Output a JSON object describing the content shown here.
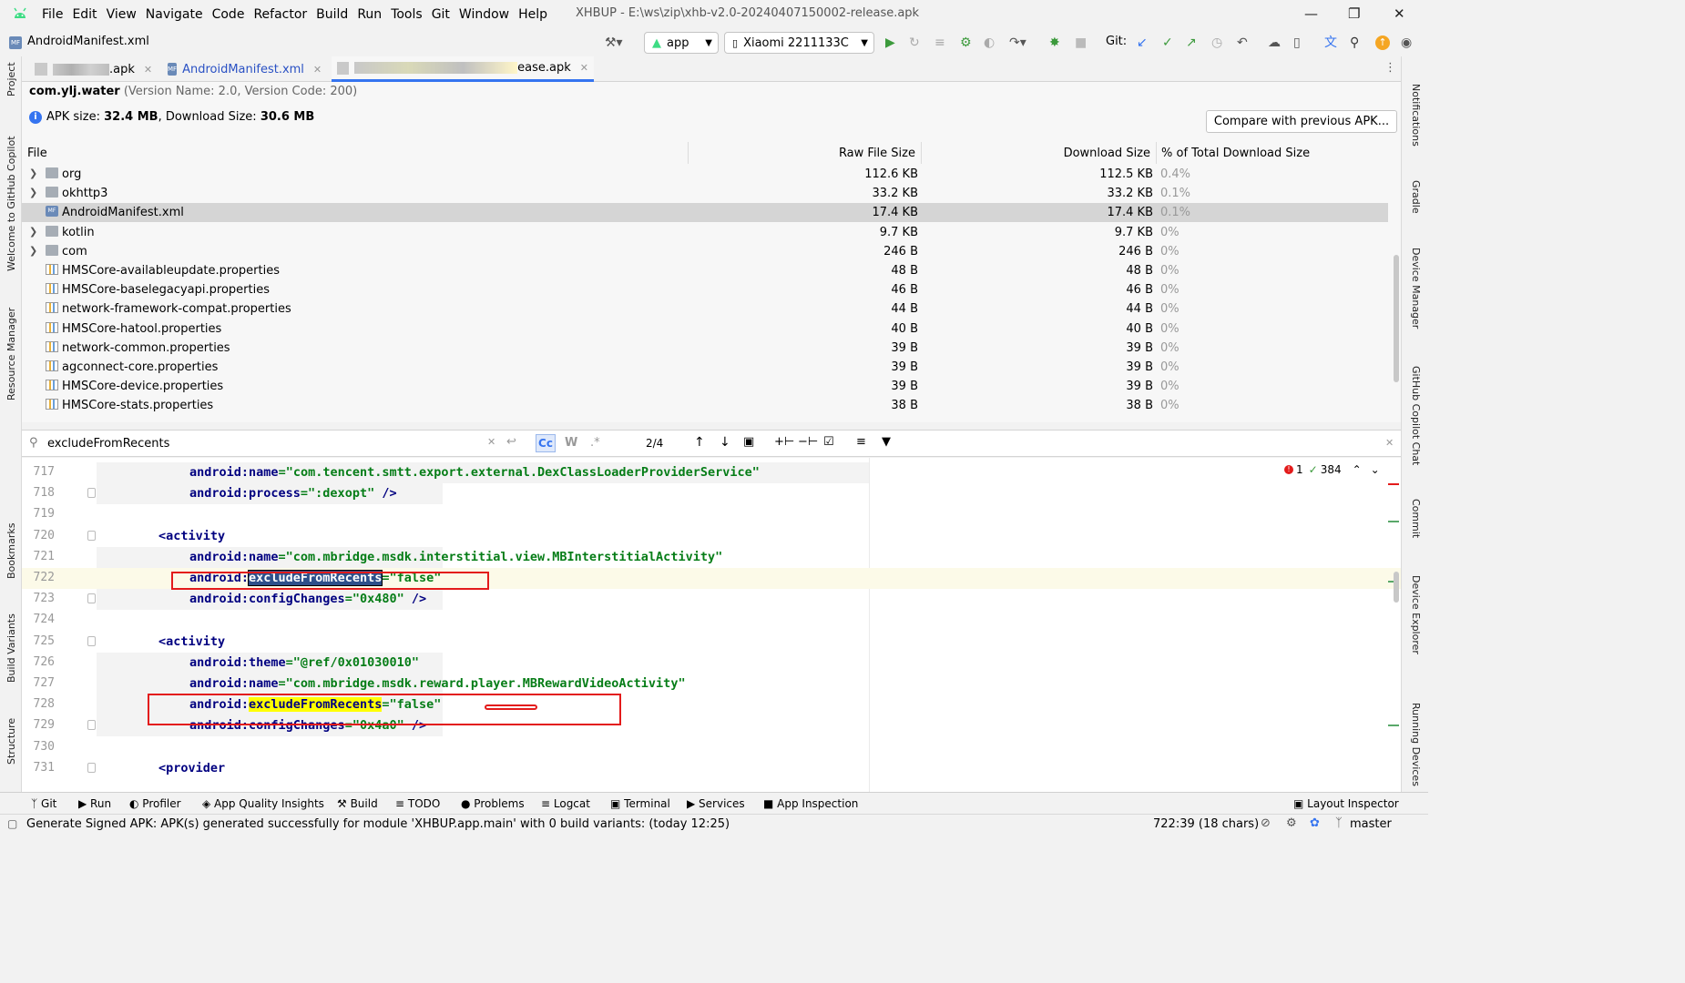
{
  "menu": [
    "File",
    "Edit",
    "View",
    "Navigate",
    "Code",
    "Refactor",
    "Build",
    "Run",
    "Tools",
    "Git",
    "Window",
    "Help"
  ],
  "window_title": "XHBUP - E:\\ws\\zip\\xhb-v2.0-20240407150002-release.apk",
  "breadcrumb": "AndroidManifest.xml",
  "toolbar": {
    "run_config": "app",
    "device": "Xiaomi 2211133C",
    "git_label": "Git:"
  },
  "tabs": [
    {
      "label": ".apk"
    },
    {
      "label": "AndroidManifest.xml"
    },
    {
      "label": "ease.apk"
    }
  ],
  "apk": {
    "package": "com.ylj.water",
    "version": "(Version Name: 2.0, Version Code: 200)",
    "size_label": "APK size:",
    "size": "32.4 MB",
    "dl_label": ", Download Size:",
    "dl_size": "30.6 MB",
    "compare_button": "Compare with previous APK..."
  },
  "table": {
    "headers": [
      "File",
      "Raw File Size",
      "Download Size",
      "% of Total Download Size"
    ],
    "rows": [
      {
        "name": "org",
        "raw": "112.6 KB",
        "dl": "112.5 KB",
        "pct": "0.4%",
        "type": "folder"
      },
      {
        "name": "okhttp3",
        "raw": "33.2 KB",
        "dl": "33.2 KB",
        "pct": "0.1%",
        "type": "folder"
      },
      {
        "name": "AndroidManifest.xml",
        "raw": "17.4 KB",
        "dl": "17.4 KB",
        "pct": "0.1%",
        "type": "manifest"
      },
      {
        "name": "kotlin",
        "raw": "9.7 KB",
        "dl": "9.7 KB",
        "pct": "0%",
        "type": "folder"
      },
      {
        "name": "com",
        "raw": "246 B",
        "dl": "246 B",
        "pct": "0%",
        "type": "folder"
      },
      {
        "name": "HMSCore-availableupdate.properties",
        "raw": "48 B",
        "dl": "48 B",
        "pct": "0%",
        "type": "prop"
      },
      {
        "name": "HMSCore-baselegacyapi.properties",
        "raw": "46 B",
        "dl": "46 B",
        "pct": "0%",
        "type": "prop"
      },
      {
        "name": "network-framework-compat.properties",
        "raw": "44 B",
        "dl": "44 B",
        "pct": "0%",
        "type": "prop"
      },
      {
        "name": "HMSCore-hatool.properties",
        "raw": "40 B",
        "dl": "40 B",
        "pct": "0%",
        "type": "prop"
      },
      {
        "name": "network-common.properties",
        "raw": "39 B",
        "dl": "39 B",
        "pct": "0%",
        "type": "prop"
      },
      {
        "name": "agconnect-core.properties",
        "raw": "39 B",
        "dl": "39 B",
        "pct": "0%",
        "type": "prop"
      },
      {
        "name": "HMSCore-device.properties",
        "raw": "39 B",
        "dl": "39 B",
        "pct": "0%",
        "type": "prop"
      },
      {
        "name": "HMSCore-stats.properties",
        "raw": "38 B",
        "dl": "38 B",
        "pct": "0%",
        "type": "prop"
      }
    ]
  },
  "search": {
    "query": "excludeFromRecents",
    "match_count": "2/4",
    "cc": "Cc",
    "w": "W",
    "regex": ".*"
  },
  "inspections": {
    "errors": "1",
    "warnings": "384"
  },
  "code": [
    {
      "n": "717",
      "parts": [
        {
          "t": "android",
          "c": "at"
        },
        {
          "t": ":",
          "c": "at"
        },
        {
          "t": "name",
          "c": "at"
        },
        {
          "t": "=\"com.tencent.smtt.export.external.DexClassLoaderProviderService\"",
          "c": "sv"
        }
      ],
      "indent": 1
    },
    {
      "n": "718",
      "parts": [
        {
          "t": "android:process",
          "c": "at"
        },
        {
          "t": "=\":dexopt\"",
          "c": "sv"
        },
        {
          "t": " />",
          "c": "tg"
        }
      ],
      "indent": 1
    },
    {
      "n": "719",
      "parts": [],
      "indent": 0
    },
    {
      "n": "720",
      "parts": [
        {
          "t": "<activity",
          "c": "tg"
        }
      ],
      "indent": 0
    },
    {
      "n": "721",
      "parts": [
        {
          "t": "android:name",
          "c": "at"
        },
        {
          "t": "=\"com.mbridge.msdk.interstitial.view.MBInterstitialActivity\"",
          "c": "sv"
        }
      ],
      "indent": 1
    },
    {
      "n": "722",
      "parts": [
        {
          "t": "android:",
          "c": "at"
        },
        {
          "t": "excludeFromRecents",
          "c": "hlsel"
        },
        {
          "t": "=\"false\"",
          "c": "sv"
        }
      ],
      "indent": 1
    },
    {
      "n": "723",
      "parts": [
        {
          "t": "android:configChanges",
          "c": "at"
        },
        {
          "t": "=\"0x480\"",
          "c": "sv"
        },
        {
          "t": " />",
          "c": "tg"
        }
      ],
      "indent": 1
    },
    {
      "n": "724",
      "parts": [],
      "indent": 0
    },
    {
      "n": "725",
      "parts": [
        {
          "t": "<activity",
          "c": "tg"
        }
      ],
      "indent": 0
    },
    {
      "n": "726",
      "parts": [
        {
          "t": "android:theme",
          "c": "at"
        },
        {
          "t": "=\"@ref/0x01030010\"",
          "c": "sv"
        }
      ],
      "indent": 1
    },
    {
      "n": "727",
      "parts": [
        {
          "t": "android:name",
          "c": "at"
        },
        {
          "t": "=\"com.mbridge.msdk.reward.player.MBRewardVideoActivity\"",
          "c": "sv"
        }
      ],
      "indent": 1
    },
    {
      "n": "728",
      "parts": [
        {
          "t": "android:",
          "c": "at"
        },
        {
          "t": "excludeFromRecents",
          "c": "hl"
        },
        {
          "t": "=\"false\"",
          "c": "sv"
        }
      ],
      "indent": 1
    },
    {
      "n": "729",
      "parts": [
        {
          "t": "android:configChanges",
          "c": "at"
        },
        {
          "t": "=\"0x4a0\"",
          "c": "sv"
        },
        {
          "t": " />",
          "c": "tg"
        }
      ],
      "indent": 1
    },
    {
      "n": "730",
      "parts": [],
      "indent": 0
    },
    {
      "n": "731",
      "parts": [
        {
          "t": "<provider",
          "c": "tg"
        }
      ],
      "indent": 0
    }
  ],
  "left_tools": [
    "Project",
    "Welcome to GitHub Copilot",
    "Resource Manager",
    "Bookmarks",
    "Build Variants",
    "Structure"
  ],
  "right_tools": [
    "Notifications",
    "Gradle",
    "Device Manager",
    "GitHub Copilot Chat",
    "Commit",
    "Device Explorer",
    "Running Devices"
  ],
  "bottom_tools": [
    "Git",
    "Run",
    "Profiler",
    "App Quality Insights",
    "Build",
    "TODO",
    "Problems",
    "Logcat",
    "Terminal",
    "Services",
    "App Inspection"
  ],
  "layout_inspector": "Layout Inspector",
  "status": {
    "message": "Generate Signed APK: APK(s) generated successfully for module 'XHBUP.app.main' with 0 build variants: (today 12:25)",
    "position": "722:39 (18 chars)",
    "branch": "master"
  },
  "colors": {
    "accent": "#3574f0",
    "string": "#067d17",
    "attr": "#000080",
    "highlight": "#ffff00",
    "selection": "#2d4f8a",
    "box": "#e31b1b"
  }
}
